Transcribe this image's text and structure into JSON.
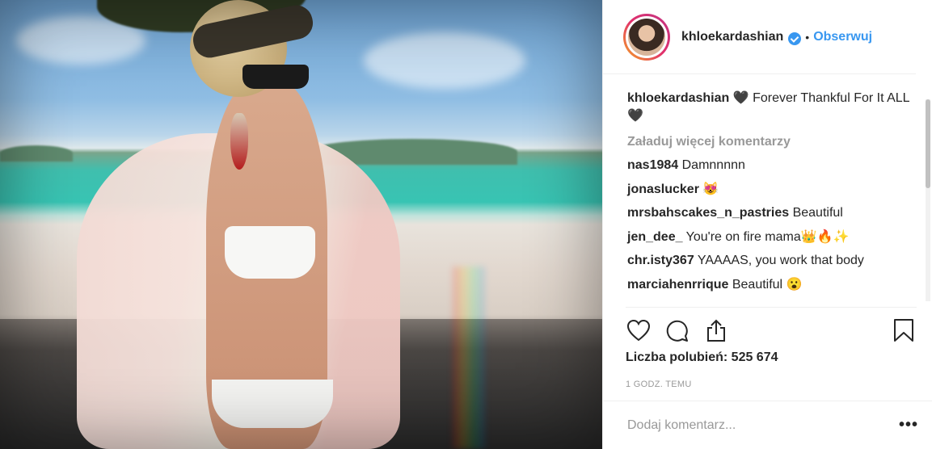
{
  "post": {
    "username": "khloekardashian",
    "verified_icon": "verified-badge-icon",
    "separator": "•",
    "follow_label": "Obserwuj"
  },
  "caption": {
    "username": "khloekardashian",
    "text": "🖤 Forever Thankful For It ALL 🖤"
  },
  "load_more_label": "Załaduj więcej komentarzy",
  "comments": [
    {
      "user": "nas1984",
      "text": "Damnnnnn"
    },
    {
      "user": "jonaslucker",
      "text": "😻"
    },
    {
      "user": "mrsbahscakes_n_pastries",
      "text": "Beautiful"
    },
    {
      "user": "jen_dee_",
      "text": "You're on fire mama👑🔥✨"
    },
    {
      "user": "chr.isty367",
      "text": "YAAAAS, you work that body"
    },
    {
      "user": "marciahenrrique",
      "text": "Beautiful 😮"
    },
    {
      "user": "...",
      "text": ""
    }
  ],
  "actions": {
    "like_icon": "heart-icon",
    "comment_icon": "comment-icon",
    "share_icon": "share-icon",
    "save_icon": "bookmark-icon"
  },
  "likes_text": "Liczba polubień: 525 674",
  "time_text": "1 GODZ. TEMU",
  "add_comment_placeholder": "Dodaj komentarz...",
  "more_options": "•••"
}
